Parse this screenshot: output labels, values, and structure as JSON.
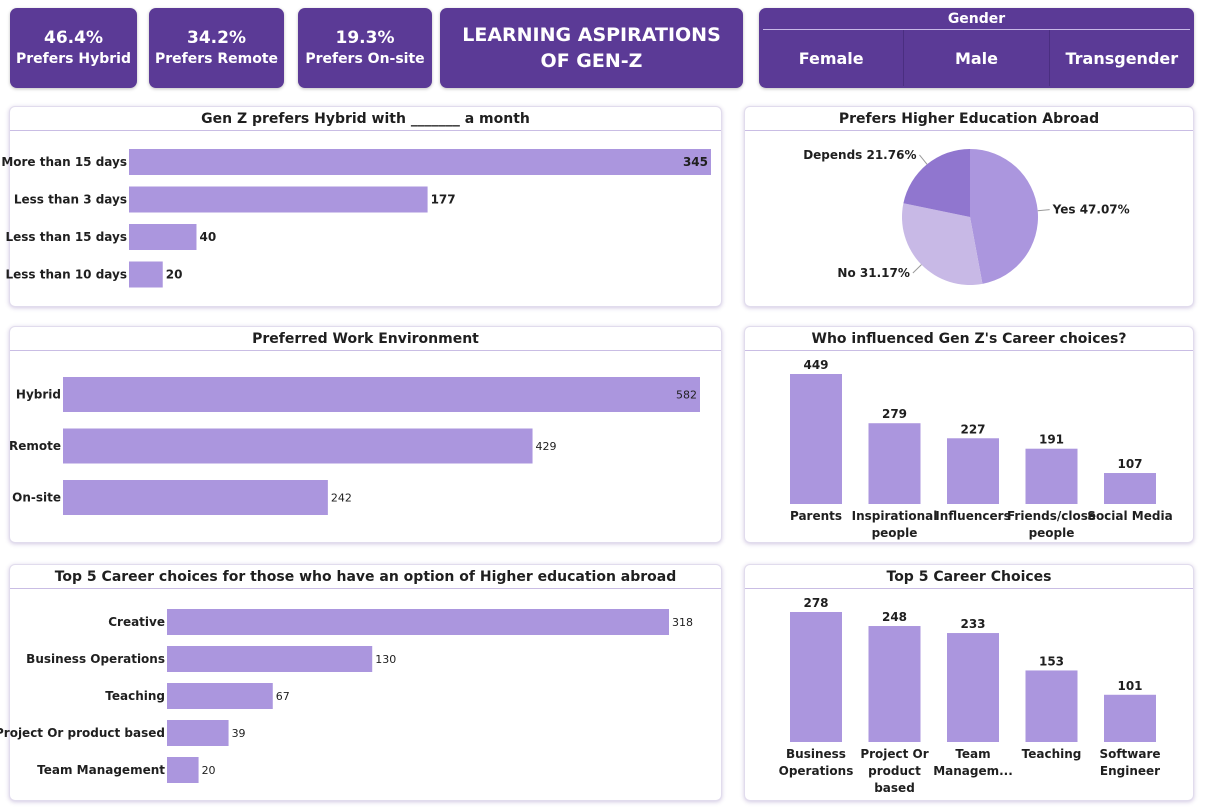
{
  "kpis": [
    {
      "value": "46.4%",
      "label": "Prefers Hybrid"
    },
    {
      "value": "34.2%",
      "label": "Prefers Remote"
    },
    {
      "value": "19.3%",
      "label": "Prefers On-site"
    }
  ],
  "header": {
    "title": "LEARNING ASPIRATIONS OF GEN-Z"
  },
  "slicer": {
    "title": "Gender",
    "options": [
      "Female",
      "Male",
      "Transgender"
    ]
  },
  "colors": {
    "bar": "#ab96de",
    "accent": "#5b3a96",
    "pie_yes": "#ab96de",
    "pie_no": "#c8b9e6",
    "pie_depends": "#9076cf"
  },
  "chart_data": [
    {
      "type": "bar",
      "orientation": "horizontal",
      "title": "Gen Z prefers Hybrid with _______ a month",
      "categories": [
        "More than 15 days",
        "Less than 3 days",
        "Less than 15 days",
        "Less than 10 days"
      ],
      "values": [
        345,
        177,
        40,
        20
      ]
    },
    {
      "type": "pie",
      "title": "Prefers Higher Education Abroad",
      "labels": [
        "Yes",
        "No",
        "Depends"
      ],
      "values": [
        47.07,
        31.17,
        21.76
      ],
      "display_labels": [
        "Yes 47.07%",
        "No 31.17%",
        "Depends 21.76%"
      ]
    },
    {
      "type": "bar",
      "orientation": "horizontal",
      "title": "Preferred Work Environment",
      "categories": [
        "Hybrid",
        "Remote",
        "On-site"
      ],
      "values": [
        582,
        429,
        242
      ]
    },
    {
      "type": "bar",
      "orientation": "vertical",
      "title": "Who influenced Gen Z's Career choices?",
      "categories": [
        "Parents",
        "Inspirational people",
        "Influencers",
        "Friends/close people",
        "Social Media"
      ],
      "category_lines": [
        [
          "Parents"
        ],
        [
          "Inspirational",
          "people"
        ],
        [
          "Influencers"
        ],
        [
          "Friends/close",
          "people"
        ],
        [
          "Social Media"
        ]
      ],
      "values": [
        449,
        279,
        227,
        191,
        107
      ]
    },
    {
      "type": "bar",
      "orientation": "horizontal",
      "title": "Top 5 Career choices for those who have an option of Higher education abroad",
      "categories": [
        "Creative",
        "Business Operations",
        "Teaching",
        "Project Or product based",
        "Team Management"
      ],
      "values": [
        318,
        130,
        67,
        39,
        20
      ]
    },
    {
      "type": "bar",
      "orientation": "vertical",
      "title": "Top 5 Career Choices",
      "categories": [
        "Business Operations",
        "Project Or product based",
        "Team Managem...",
        "Teaching",
        "Software Engineer"
      ],
      "category_lines": [
        [
          "Business",
          "Operations"
        ],
        [
          "Project Or",
          "product",
          "based"
        ],
        [
          "Team",
          "Managem..."
        ],
        [
          "Teaching"
        ],
        [
          "Software",
          "Engineer"
        ]
      ],
      "values": [
        278,
        248,
        233,
        153,
        101
      ]
    }
  ]
}
